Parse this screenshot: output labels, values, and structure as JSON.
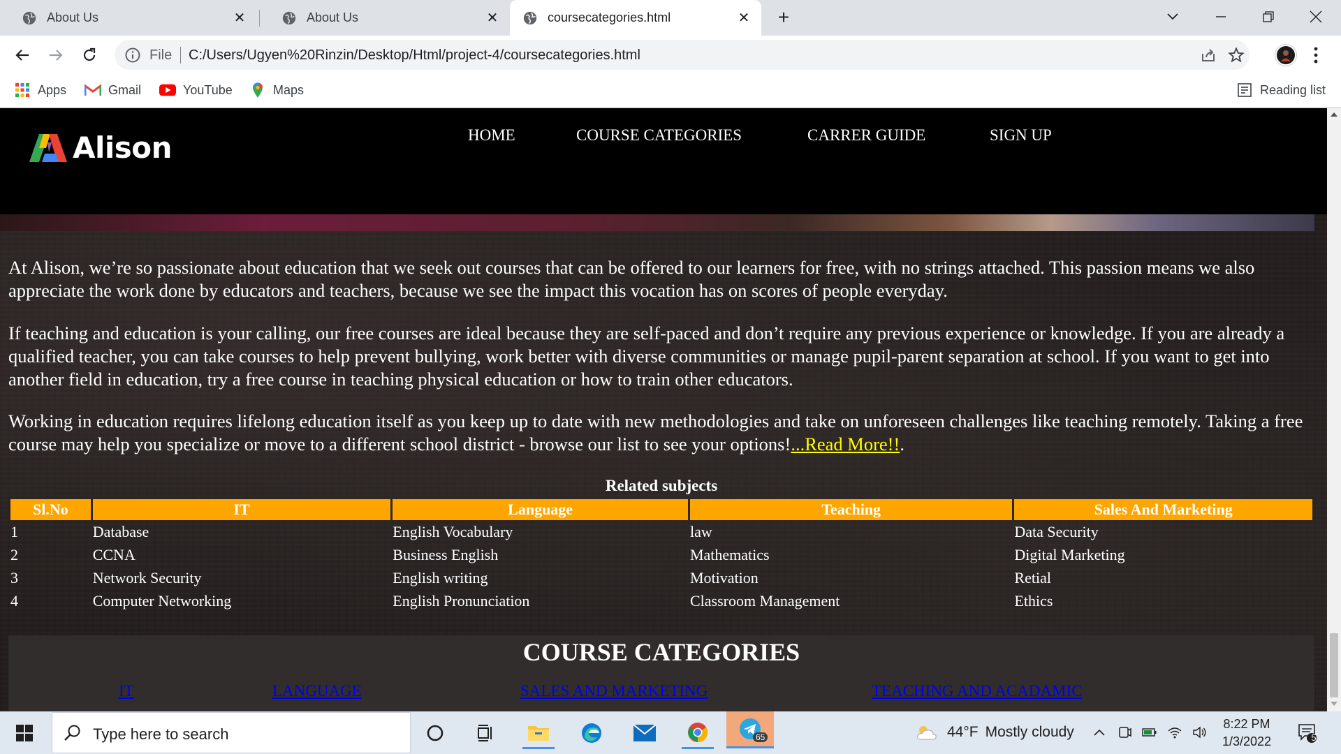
{
  "browser": {
    "tabs": [
      {
        "title": "About Us",
        "active": false
      },
      {
        "title": "About Us",
        "active": false
      },
      {
        "title": "coursecategories.html",
        "active": true
      }
    ],
    "omnibox": {
      "scheme_label": "File",
      "url": "C:/Users/Ugyen%20Rinzin/Desktop/Html/project-4/coursecategories.html"
    },
    "bookmarks": [
      {
        "label": "Apps",
        "icon": "apps-grid-icon"
      },
      {
        "label": "Gmail",
        "icon": "gmail-icon"
      },
      {
        "label": "YouTube",
        "icon": "youtube-icon"
      },
      {
        "label": "Maps",
        "icon": "maps-icon"
      }
    ],
    "reading_list": "Reading list"
  },
  "site": {
    "logo_text": "Alison",
    "nav": [
      "HOME",
      "COURSE CATEGORIES",
      "CARRER GUIDE",
      "SIGN UP"
    ],
    "paragraphs": [
      "At Alison, we’re so passionate about education that we seek out courses that can be offered to our learners for free, with no strings attached. This passion means we also appreciate the work done by educators and teachers, because we see the impact this vocation has on scores of people everyday.",
      "If teaching and education is your calling, our free courses are ideal because they are self-paced and don’t require any previous experience or knowledge. If you are already a qualified teacher, you can take courses to help prevent bullying, work better with diverse communities or manage pupil-parent separation at school. If you want to get into another field in education, try a free course in teaching physical education or how to train other educators.",
      "Working in education requires lifelong education itself as you keep up to date with new methodologies and take on unforeseen challenges like teaching remotely. Taking a free course may help you specialize or move to a different school district - browse our list to see your options!"
    ],
    "read_more": "...Read More!!",
    "read_more_suffix": ".",
    "table": {
      "caption": "Related subjects",
      "headers": [
        "Sl.No",
        "IT",
        "Language",
        "Teaching",
        "Sales And Marketing"
      ],
      "rows": [
        [
          "1",
          "Database",
          "English Vocabulary",
          "law",
          "Data Security"
        ],
        [
          "2",
          "CCNA",
          "Business English",
          "Mathematics",
          "Digital Marketing"
        ],
        [
          "3",
          "Network Security",
          "English writing",
          "Motivation",
          "Retial"
        ],
        [
          "4",
          "Computer Networking",
          "English Pronunciation",
          "Classroom Management",
          "Ethics"
        ]
      ]
    },
    "categories": {
      "title": "COURSE CATEGORIES",
      "links": [
        "IT",
        "LANGUAGE",
        "SALES AND MARKETING",
        "TEACHING AND ACADAMIC"
      ]
    }
  },
  "taskbar": {
    "search_placeholder": "Type here to search",
    "weather": {
      "temp": "44°F",
      "condition": "Mostly cloudy"
    },
    "clock": {
      "time": "8:22 PM",
      "date": "1/3/2022"
    },
    "telegram_badge": "65",
    "notification_count": "5"
  },
  "colors": {
    "table_header": "#ffa500",
    "read_more_link": "#ffff00",
    "category_link": "#0000ee",
    "header_bg": "#000000"
  }
}
